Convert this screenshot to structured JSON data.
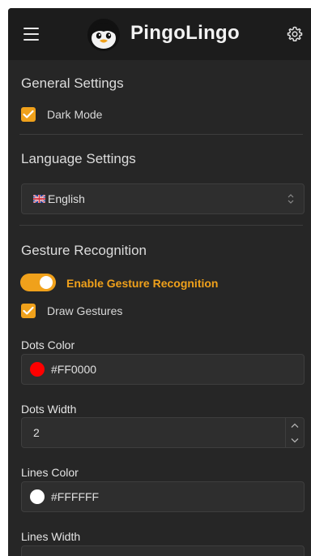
{
  "header": {
    "app_title": "PingoLingo",
    "menu_icon": "hamburger-menu-icon",
    "logo_icon": "penguin-logo-icon",
    "settings_icon": "gear-icon"
  },
  "general": {
    "title": "General Settings",
    "dark_mode_label": "Dark Mode",
    "dark_mode_checked": true
  },
  "language": {
    "title": "Language Settings",
    "selected": "English",
    "flag_icon": "uk-flag-icon"
  },
  "gesture": {
    "title": "Gesture Recognition",
    "enable_label": "Enable Gesture Recognition",
    "enabled": true,
    "draw_label": "Draw Gestures",
    "draw_checked": true,
    "dots_color_label": "Dots Color",
    "dots_color_value": "#FF0000",
    "dots_width_label": "Dots Width",
    "dots_width_value": "2",
    "lines_color_label": "Lines Color",
    "lines_color_value": "#FFFFFF",
    "lines_width_label": "Lines Width"
  },
  "colors": {
    "accent": "#f0a11b",
    "background": "#262626",
    "header": "#1c1c1c"
  }
}
